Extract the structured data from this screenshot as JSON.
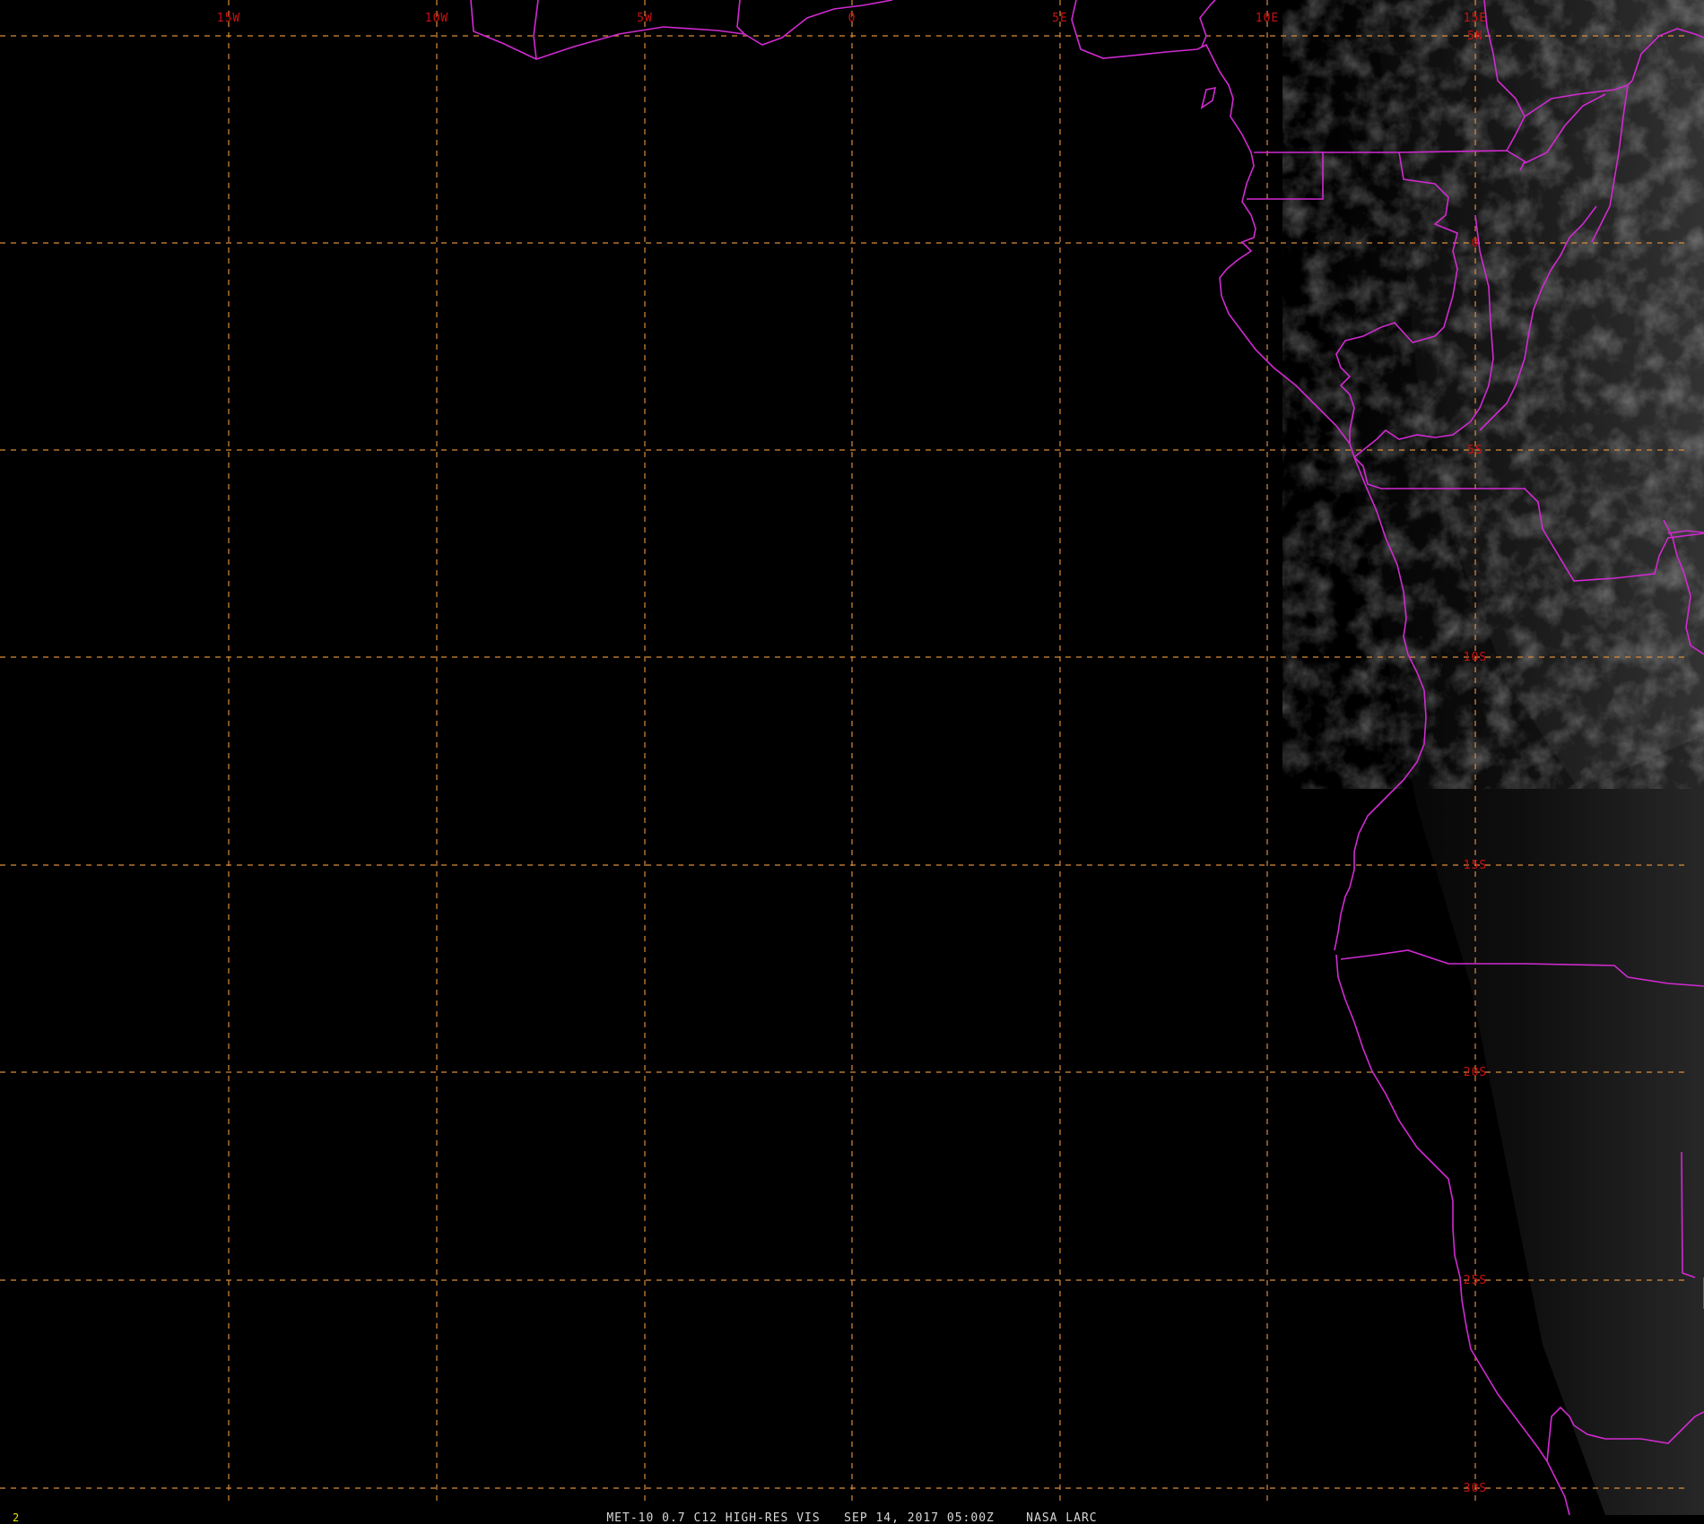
{
  "map": {
    "lon_labels": [
      "15W",
      "10W",
      "5W",
      "0",
      "5E",
      "10E",
      "15E"
    ],
    "lat_labels": [
      "5N",
      "0",
      "5S",
      "10S",
      "15S",
      "20S",
      "25S",
      "30S"
    ],
    "colors": {
      "background": "#000000",
      "grid": "#d98c3a",
      "boundaries": "#d12ad1",
      "grid_labels": "#cc1111",
      "footer_text": "#d8d8d8",
      "frame_number": "#e6e600"
    }
  },
  "footer": {
    "frame_number": "2",
    "caption": "MET-10 0.7 C12 HIGH-RES VIS   SEP 14, 2017 05:00Z    NASA LARC"
  }
}
